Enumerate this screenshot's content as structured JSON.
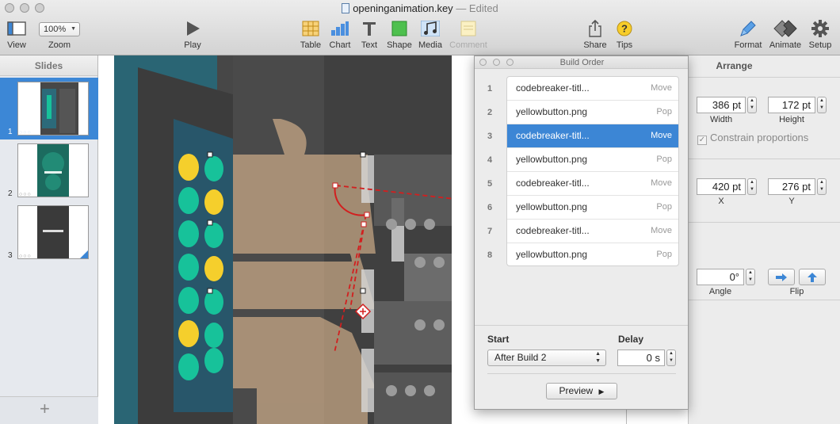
{
  "window": {
    "title": "openinganimation.key",
    "status": "— Edited"
  },
  "toolbar": {
    "view_label": "View",
    "zoom_value": "100%",
    "zoom_label": "Zoom",
    "play_label": "Play",
    "table_label": "Table",
    "chart_label": "Chart",
    "text_label": "Text",
    "shape_label": "Shape",
    "media_label": "Media",
    "comment_label": "Comment",
    "share_label": "Share",
    "tips_label": "Tips",
    "format_label": "Format",
    "animate_label": "Animate",
    "setup_label": "Setup"
  },
  "sidebar": {
    "title": "Slides",
    "slides": [
      {
        "number": "1",
        "selected": true
      },
      {
        "number": "2",
        "selected": false
      },
      {
        "number": "3",
        "selected": false
      }
    ]
  },
  "build_order": {
    "title": "Build Order",
    "items": [
      {
        "num": "1",
        "name": "codebreaker-titl...",
        "effect": "Move"
      },
      {
        "num": "2",
        "name": "yellowbutton.png",
        "effect": "Pop"
      },
      {
        "num": "3",
        "name": "codebreaker-titl...",
        "effect": "Move"
      },
      {
        "num": "4",
        "name": "yellowbutton.png",
        "effect": "Pop"
      },
      {
        "num": "5",
        "name": "codebreaker-titl...",
        "effect": "Move"
      },
      {
        "num": "6",
        "name": "yellowbutton.png",
        "effect": "Pop"
      },
      {
        "num": "7",
        "name": "codebreaker-titl...",
        "effect": "Move"
      },
      {
        "num": "8",
        "name": "yellowbutton.png",
        "effect": "Pop"
      }
    ],
    "selected_index": 3,
    "start_label": "Start",
    "start_value": "After Build 2",
    "delay_label": "Delay",
    "delay_value": "0 s",
    "preview_label": "Preview"
  },
  "arrange": {
    "title": "Arrange",
    "width_value": "386 pt",
    "width_label": "Width",
    "height_value": "172 pt",
    "height_label": "Height",
    "constrain_label": "Constrain proportions",
    "x_value": "420 pt",
    "x_label": "X",
    "y_value": "276 pt",
    "y_label": "Y",
    "angle_value": "0°",
    "angle_label": "Angle",
    "flip_label": "Flip"
  },
  "colors": {
    "selection_blue": "#3c86d5",
    "slide_teal": "#2e6a7a",
    "button_green": "#17c29a",
    "button_yellow": "#f5cf2c",
    "motion_path_red": "#d21f1f"
  }
}
